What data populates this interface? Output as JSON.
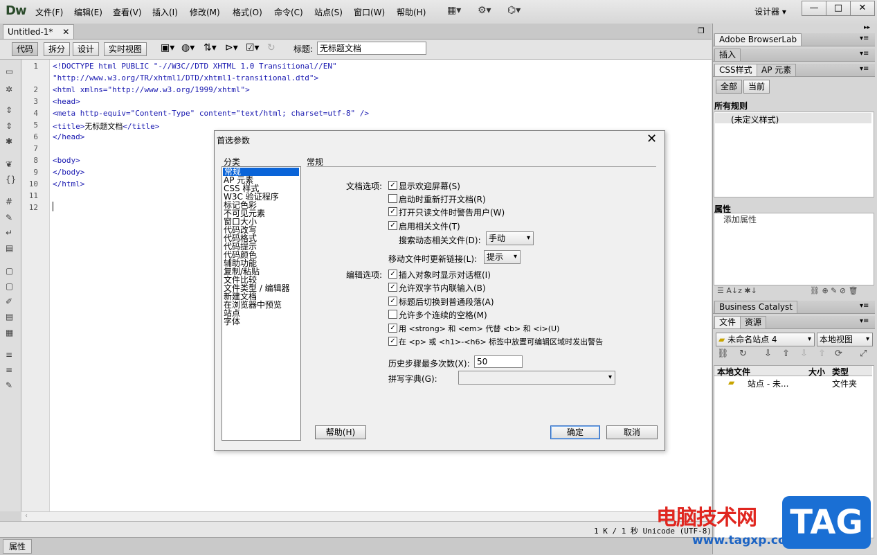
{
  "app": {
    "logo": "Dw",
    "mode": "设计器",
    "mode_arrow": "▾"
  },
  "menu": [
    "文件(F)",
    "编辑(E)",
    "查看(V)",
    "插入(I)",
    "修改(M)",
    "格式(O)",
    "命令(C)",
    "站点(S)",
    "窗口(W)",
    "帮助(H)"
  ],
  "window_controls": {
    "minimize": "—",
    "maximize": "□",
    "close": "✕"
  },
  "document": {
    "tab": "Untitled-1*",
    "tab_close": "✕",
    "views": [
      "代码",
      "拆分",
      "设计",
      "实时视图"
    ],
    "title_label": "标题:",
    "title_value": "无标题文档"
  },
  "code_lines": [
    {
      "n": "1",
      "code": "<!DOCTYPE html PUBLIC \"-//W3C//DTD XHTML 1.0 Transitional//EN\""
    },
    {
      "n": "",
      "code": "\"http://www.w3.org/TR/xhtml1/DTD/xhtml1-transitional.dtd\">"
    },
    {
      "n": "2",
      "code": "<html xmlns=\"http://www.w3.org/1999/xhtml\">"
    },
    {
      "n": "3",
      "code": "<head>"
    },
    {
      "n": "4",
      "code": "<meta http-equiv=\"Content-Type\" content=\"text/html; charset=utf-8\" />"
    },
    {
      "n": "5",
      "code": "<title>",
      "text": "无标题文档",
      "code_end": "</title>"
    },
    {
      "n": "6",
      "code": "</head>"
    },
    {
      "n": "7",
      "code": ""
    },
    {
      "n": "8",
      "code": "<body>"
    },
    {
      "n": "9",
      "code": "</body>"
    },
    {
      "n": "10",
      "code": "</html>"
    },
    {
      "n": "11",
      "code": ""
    },
    {
      "n": "12",
      "code": ""
    }
  ],
  "status": {
    "text": "1 K / 1 秒 Unicode (UTF-8)"
  },
  "properties_tab": "属性",
  "right": {
    "browserlab": "Adobe BrowserLab",
    "insert": "插入",
    "css_tabs": [
      "CSS样式",
      "AP 元素"
    ],
    "css_buttons": [
      "全部",
      "当前"
    ],
    "all_rules": "所有规则",
    "undefined_style": "(未定义样式)",
    "properties": "属性",
    "add_property": "添加属性",
    "business_catalyst": "Business Catalyst",
    "files_tabs": [
      "文件",
      "资源"
    ],
    "site_select": "未命名站点 4",
    "view_select": "本地视图",
    "file_columns": [
      "本地文件",
      "大小",
      "类型"
    ],
    "file_row": {
      "name": "站点 - 未...",
      "type": "文件夹"
    }
  },
  "dialog": {
    "title": "首选参数",
    "close": "✕",
    "category_label": "分类",
    "categories": [
      "常规",
      "AP 元素",
      "CSS 样式",
      "W3C 验证程序",
      "标记色彩",
      "不可见元素",
      "窗口大小",
      "代码改写",
      "代码格式",
      "代码提示",
      "代码颜色",
      "辅助功能",
      "复制/粘贴",
      "文件比较",
      "文件类型 / 编辑器",
      "新建文档",
      "在浏览器中预览",
      "站点",
      "字体"
    ],
    "section": "常规",
    "doc_options_label": "文档选项:",
    "doc_options": [
      {
        "label": "显示欢迎屏幕(S)",
        "checked": true
      },
      {
        "label": "启动时重新打开文档(R)",
        "checked": false
      },
      {
        "label": "打开只读文件时警告用户(W)",
        "checked": true
      },
      {
        "label": "启用相关文件(T)",
        "checked": true
      }
    ],
    "search_related_label": "搜索动态相关文件(D):",
    "search_related_value": "手动",
    "update_links_label": "移动文件时更新链接(L):",
    "update_links_value": "提示",
    "edit_options_label": "编辑选项:",
    "edit_options": [
      {
        "label": "插入对象时显示对话框(I)",
        "checked": true
      },
      {
        "label": "允许双字节内联输入(B)",
        "checked": true
      },
      {
        "label": "标题后切换到普通段落(A)",
        "checked": true
      },
      {
        "label": "允许多个连续的空格(M)",
        "checked": false
      },
      {
        "label": "用 <strong> 和 <em> 代替 <b> 和 <i>(U)",
        "checked": true
      },
      {
        "label": "在 <p> 或 <h1>-<h6> 标签中放置可编辑区域时发出警告",
        "checked": true
      }
    ],
    "history_label": "历史步骤最多次数(X):",
    "history_value": "50",
    "spell_label": "拼写字典(G):",
    "spell_value": "",
    "help_button": "帮助(H)",
    "ok_button": "确定",
    "cancel_button": "取消"
  },
  "watermark": {
    "text": "电脑技术网",
    "url": "www.tagxp.com",
    "logo": "TAG"
  },
  "colors": {
    "selection": "#0a64d8",
    "code_tag": "#1818b0",
    "watermark_red": "#e0261f",
    "watermark_blue": "#1a6fd4"
  }
}
